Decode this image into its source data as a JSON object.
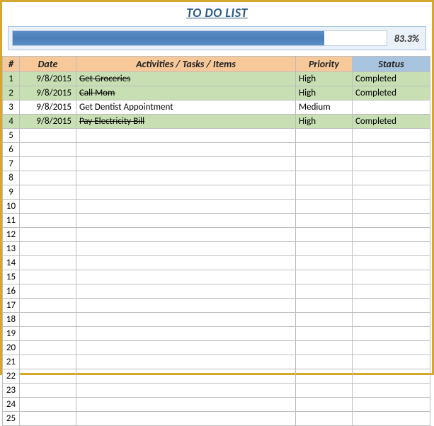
{
  "title": "TO DO LIST",
  "progress": {
    "percent_label": "83.3%",
    "percent_value": 83.3
  },
  "headers": {
    "num": "#",
    "date": "Date",
    "activity": "Activities / Tasks / Items",
    "priority": "Priority",
    "status": "Status"
  },
  "rows": [
    {
      "num": "1",
      "date": "9/8/2015",
      "activity": "Get Groceries",
      "priority": "High",
      "status": "Completed",
      "strike": true,
      "highlight": true
    },
    {
      "num": "2",
      "date": "9/8/2015",
      "activity": "Call Mom",
      "priority": "High",
      "status": "Completed",
      "strike": true,
      "highlight": true
    },
    {
      "num": "3",
      "date": "9/8/2015",
      "activity": "Get Dentist Appointment",
      "priority": "Medium",
      "status": "",
      "strike": false,
      "highlight": false
    },
    {
      "num": "4",
      "date": "9/8/2015",
      "activity": "Pay Electricity Bill",
      "priority": "High",
      "status": "Completed",
      "strike": true,
      "highlight": true
    },
    {
      "num": "5",
      "date": "",
      "activity": "",
      "priority": "",
      "status": "",
      "strike": false,
      "highlight": false
    },
    {
      "num": "6",
      "date": "",
      "activity": "",
      "priority": "",
      "status": "",
      "strike": false,
      "highlight": false
    },
    {
      "num": "7",
      "date": "",
      "activity": "",
      "priority": "",
      "status": "",
      "strike": false,
      "highlight": false
    },
    {
      "num": "8",
      "date": "",
      "activity": "",
      "priority": "",
      "status": "",
      "strike": false,
      "highlight": false
    },
    {
      "num": "9",
      "date": "",
      "activity": "",
      "priority": "",
      "status": "",
      "strike": false,
      "highlight": false
    },
    {
      "num": "10",
      "date": "",
      "activity": "",
      "priority": "",
      "status": "",
      "strike": false,
      "highlight": false
    },
    {
      "num": "11",
      "date": "",
      "activity": "",
      "priority": "",
      "status": "",
      "strike": false,
      "highlight": false
    },
    {
      "num": "12",
      "date": "",
      "activity": "",
      "priority": "",
      "status": "",
      "strike": false,
      "highlight": false
    },
    {
      "num": "13",
      "date": "",
      "activity": "",
      "priority": "",
      "status": "",
      "strike": false,
      "highlight": false
    },
    {
      "num": "14",
      "date": "",
      "activity": "",
      "priority": "",
      "status": "",
      "strike": false,
      "highlight": false
    },
    {
      "num": "15",
      "date": "",
      "activity": "",
      "priority": "",
      "status": "",
      "strike": false,
      "highlight": false
    },
    {
      "num": "16",
      "date": "",
      "activity": "",
      "priority": "",
      "status": "",
      "strike": false,
      "highlight": false
    },
    {
      "num": "17",
      "date": "",
      "activity": "",
      "priority": "",
      "status": "",
      "strike": false,
      "highlight": false
    },
    {
      "num": "18",
      "date": "",
      "activity": "",
      "priority": "",
      "status": "",
      "strike": false,
      "highlight": false
    },
    {
      "num": "19",
      "date": "",
      "activity": "",
      "priority": "",
      "status": "",
      "strike": false,
      "highlight": false
    },
    {
      "num": "20",
      "date": "",
      "activity": "",
      "priority": "",
      "status": "",
      "strike": false,
      "highlight": false
    },
    {
      "num": "21",
      "date": "",
      "activity": "",
      "priority": "",
      "status": "",
      "strike": false,
      "highlight": false
    },
    {
      "num": "22",
      "date": "",
      "activity": "",
      "priority": "",
      "status": "",
      "strike": false,
      "highlight": false
    },
    {
      "num": "23",
      "date": "",
      "activity": "",
      "priority": "",
      "status": "",
      "strike": false,
      "highlight": false
    },
    {
      "num": "24",
      "date": "",
      "activity": "",
      "priority": "",
      "status": "",
      "strike": false,
      "highlight": false
    },
    {
      "num": "25",
      "date": "",
      "activity": "",
      "priority": "",
      "status": "",
      "strike": false,
      "highlight": false
    }
  ]
}
